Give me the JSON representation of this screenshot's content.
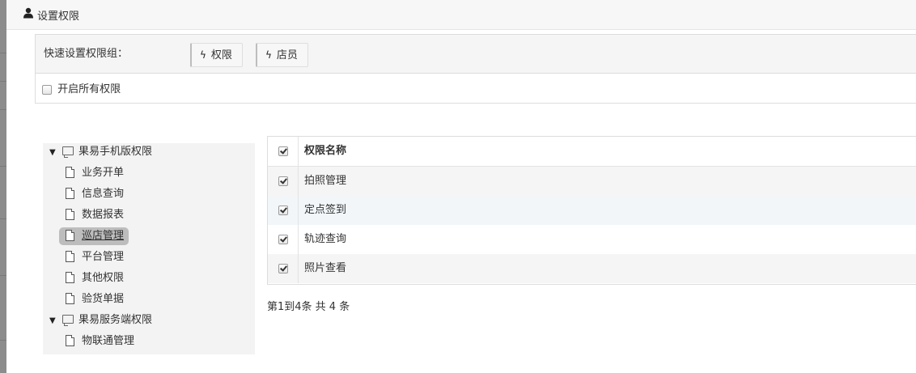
{
  "header": {
    "title": "设置权限",
    "icon": "user-icon"
  },
  "quick": {
    "label": "快速设置权限组：",
    "buttons": [
      {
        "label": "权限",
        "icon": "bolt-icon"
      },
      {
        "label": "店员",
        "icon": "bolt-icon"
      }
    ],
    "open_all": {
      "label": "开启所有权限",
      "checked": false
    }
  },
  "tree": {
    "groups": [
      {
        "label": "果易手机版权限",
        "expanded": true,
        "children": [
          "业务开单",
          "信息查询",
          "数据报表",
          "巡店管理",
          "平台管理",
          "其他权限",
          "验货单据"
        ]
      },
      {
        "label": "果易服务端权限",
        "expanded": true,
        "children": [
          "物联通管理"
        ]
      }
    ],
    "selected": "巡店管理"
  },
  "table": {
    "header": "权限名称",
    "header_checked": true,
    "rows": [
      {
        "name": "拍照管理",
        "checked": true
      },
      {
        "name": "定点签到",
        "checked": true
      },
      {
        "name": "轨迹查询",
        "checked": true
      },
      {
        "name": "照片查看",
        "checked": true
      }
    ]
  },
  "pagination": {
    "text": "第1到4条 共 4 条"
  },
  "colors": {
    "row_alt": "#f5f5f5",
    "row_hover": "#f2f6f9",
    "selected_node": "#bdbdbd"
  }
}
